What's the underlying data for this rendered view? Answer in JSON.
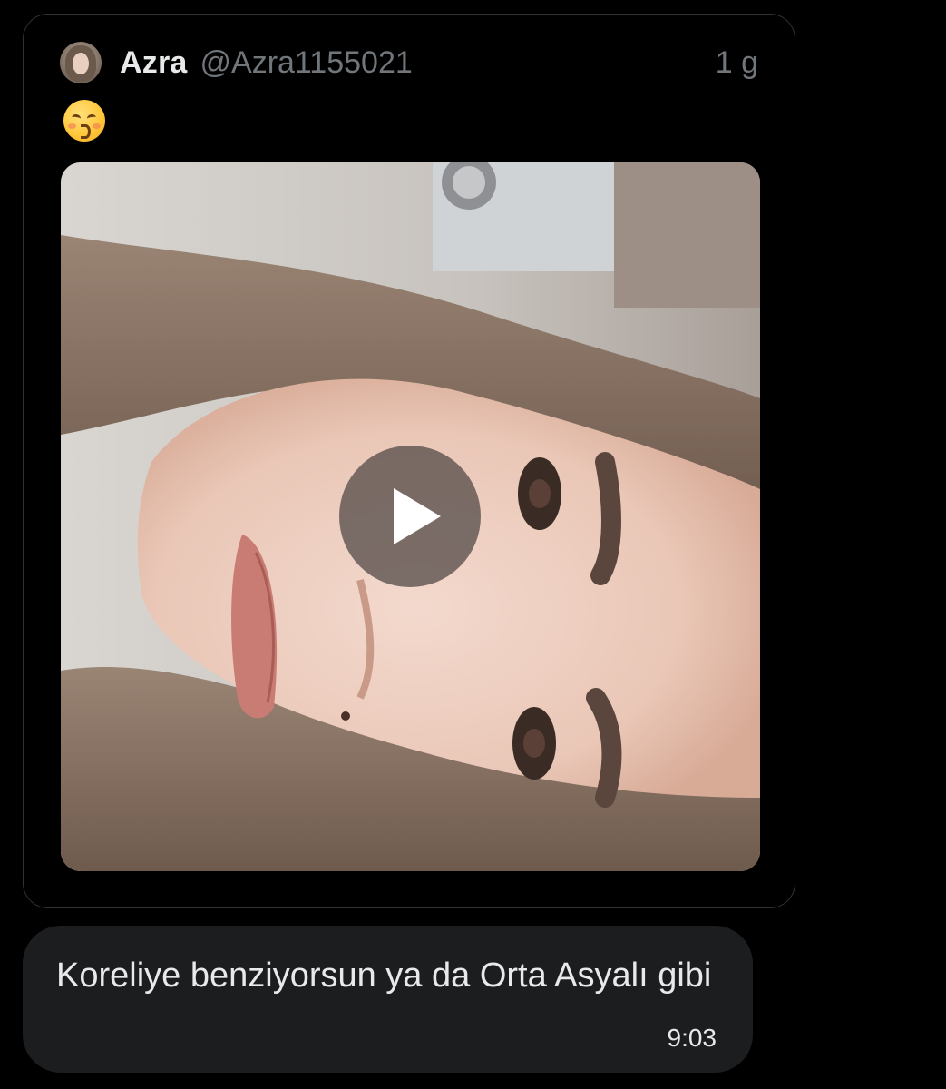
{
  "tweet": {
    "author": {
      "display_name": "Azra",
      "handle": "@Azra1155021",
      "avatar_icon": "user-avatar-photo"
    },
    "time_ago": "1 g",
    "text_emoji_icon": "kissing-face-with-smiling-eyes-icon",
    "media": {
      "type": "video",
      "play_icon": "play-icon"
    }
  },
  "message": {
    "text": "Koreliye benziyorsun ya da Orta Asyalı gibi",
    "time": "9:03"
  },
  "colors": {
    "background": "#000000",
    "card_border": "#2f3336",
    "primary_text": "#e7e9ea",
    "secondary_text": "#71767b",
    "bubble": "#1c1d1f"
  }
}
